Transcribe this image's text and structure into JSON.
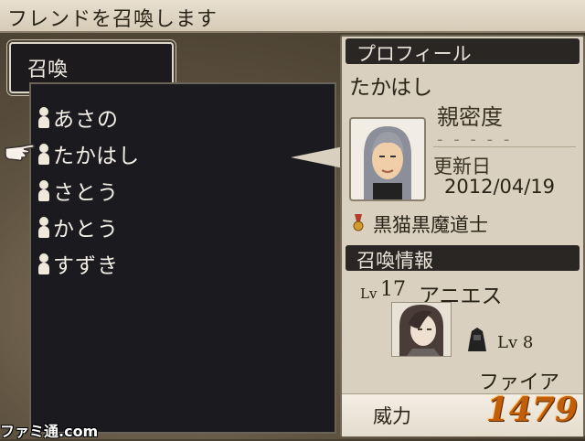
{
  "header": {
    "title": "フレンドを召喚します"
  },
  "tab": {
    "label": "召喚"
  },
  "friends": [
    {
      "name": "あさの"
    },
    {
      "name": "たかはし"
    },
    {
      "name": "さとう"
    },
    {
      "name": "かとう"
    },
    {
      "name": "すずき"
    }
  ],
  "selected_index": 1,
  "profile": {
    "heading": "プロフィール",
    "name": "たかはし",
    "intimacy_label": "親密度",
    "intimacy_value": "- - - - -",
    "updated_label": "更新日",
    "updated_date": "2012/04/19",
    "job": "黒猫黒魔道士"
  },
  "summon": {
    "heading": "召喚情報",
    "level_prefix": "Lv",
    "level": "17",
    "name": "アニエス",
    "sub_level": "Lv 8",
    "spell": "ファイア",
    "power_label": "威力",
    "power_value": "1479"
  },
  "watermark": "ファミ通.com",
  "colors": {
    "power": "#c25e0a",
    "panel_dark": "#1b1a1e",
    "panel_light": "#d9d0bf"
  }
}
